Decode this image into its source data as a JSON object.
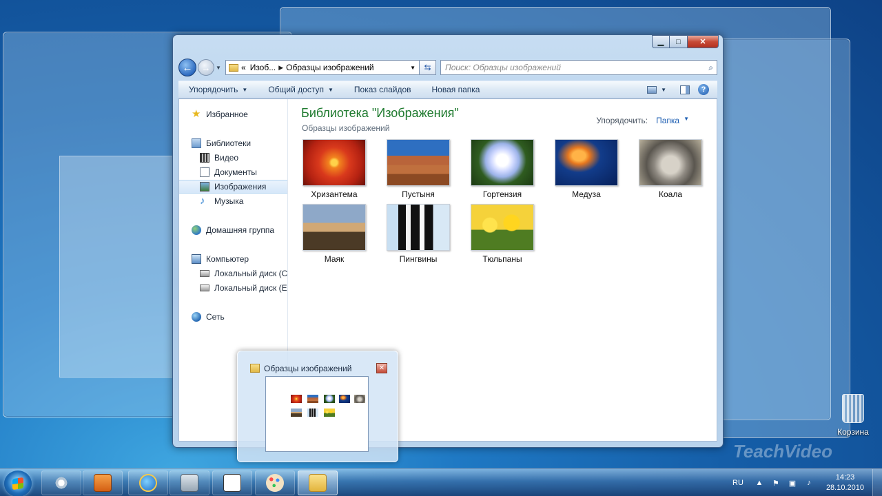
{
  "window": {
    "address_parts": [
      "«",
      "Изоб...",
      "Образцы изображений"
    ],
    "search_placeholder": "Поиск: Образцы изображений",
    "caption": {
      "minimize": "▁",
      "maximize": "□",
      "close": "✕"
    }
  },
  "toolbar": {
    "organize": "Упорядочить",
    "share": "Общий доступ",
    "slideshow": "Показ слайдов",
    "new_folder": "Новая папка",
    "help": "?"
  },
  "navpane": {
    "favorites": "Избранное",
    "libraries": "Библиотеки",
    "video": "Видео",
    "documents": "Документы",
    "images": "Изображения",
    "music": "Музыка",
    "homegroup": "Домашняя группа",
    "computer": "Компьютер",
    "disk_c": "Локальный диск (C:)",
    "disk_e": "Локальный диск (E:)",
    "network": "Сеть"
  },
  "content": {
    "title": "Библиотека \"Изображения\"",
    "subtitle": "Образцы изображений",
    "arrange_label": "Упорядочить:",
    "arrange_value": "Папка",
    "items": [
      "Хризантема",
      "Пустыня",
      "Гортензия",
      "Медуза",
      "Коала",
      "Маяк",
      "Пингвины",
      "Тюльпаны"
    ]
  },
  "peek": {
    "title": "Образцы изображений",
    "close": "✕"
  },
  "desktop": {
    "recycle_bin": "Корзина",
    "watermark": "TeachVideo"
  },
  "taskbar": {
    "lang": "RU",
    "time": "14:23",
    "date": "28.10.2010"
  }
}
